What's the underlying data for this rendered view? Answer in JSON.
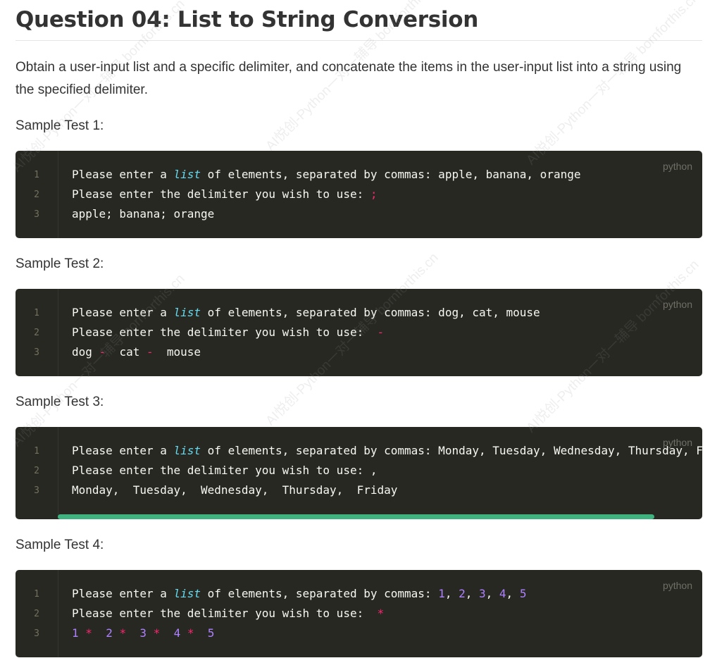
{
  "title": "Question 04: List to String Conversion",
  "intro": "Obtain a user-input list and a specific delimiter, and concatenate the items in the user-input list into a string using the specified delimiter.",
  "watermark": "AI悦创-Python一对一辅导 bornforthis.cn",
  "tests": [
    {
      "label": "Sample Test 1:",
      "lang": "python",
      "line_numbers": [
        "1",
        "2",
        "3"
      ],
      "lines": [
        {
          "pre": "Please enter a ",
          "kw": "list",
          "post": " of elements, separated by commas: apple, banana, orange"
        },
        {
          "prompt": "Please enter the delimiter you wish to use: ",
          "delim": ";"
        },
        {
          "result": "apple; banana; orange"
        }
      ]
    },
    {
      "label": "Sample Test 2:",
      "lang": "python",
      "line_numbers": [
        "1",
        "2",
        "3"
      ],
      "lines": [
        {
          "pre": "Please enter a ",
          "kw": "list",
          "post": " of elements, separated by commas: dog, cat, mouse"
        },
        {
          "prompt": "Please enter the delimiter you wish to use:  ",
          "delim": "-"
        },
        {
          "w1": "dog ",
          "d1": "-",
          "w2": "  cat ",
          "d2": "-",
          "w3": "  mouse"
        }
      ]
    },
    {
      "label": "Sample Test 3:",
      "lang": "python",
      "line_numbers": [
        "1",
        "2",
        "3"
      ],
      "lines": [
        {
          "pre": "Please enter a ",
          "kw": "list",
          "post": " of elements, separated by commas: Monday, Tuesday, Wednesday, Thursday, F"
        },
        {
          "prompt": "Please enter the delimiter you wish to use: ,"
        },
        {
          "result": "Monday,  Tuesday,  Wednesday,  Thursday,  Friday"
        }
      ]
    },
    {
      "label": "Sample Test 4:",
      "lang": "python",
      "line_numbers": [
        "1",
        "2",
        "3"
      ],
      "lines": [
        {
          "pre": "Please enter a ",
          "kw": "list",
          "post": " of elements, separated by commas: ",
          "nums": [
            "1",
            "2",
            "3",
            "4",
            "5"
          ]
        },
        {
          "prompt": "Please enter the delimiter you wish to use:  ",
          "delim": "*"
        },
        {
          "nums": [
            "1",
            "2",
            "3",
            "4",
            "5"
          ],
          "sep": "*"
        }
      ]
    }
  ]
}
